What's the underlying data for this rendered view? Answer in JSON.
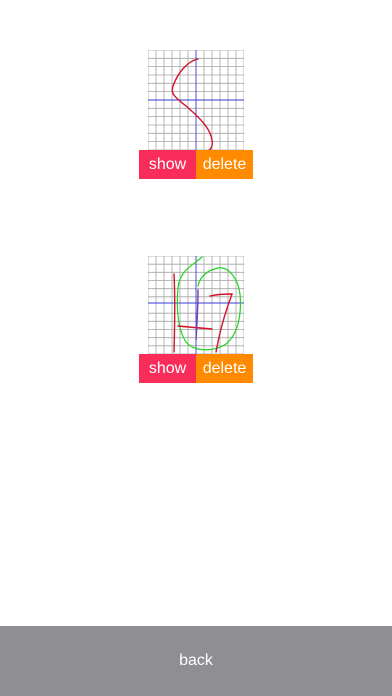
{
  "drawings": [
    {
      "show_label": "show",
      "delete_label": "delete",
      "stroke_colors": [
        "#d0132a"
      ]
    },
    {
      "show_label": "show",
      "delete_label": "delete",
      "stroke_colors": [
        "#d0132a",
        "#1ed51e",
        "#7a3aa8"
      ]
    }
  ],
  "bottom_bar": {
    "back_label": "back"
  },
  "colors": {
    "show_button": "#fa2d5a",
    "delete_button": "#ff8a00",
    "bottom_bar": "#8e8e93",
    "grid_line": "#9a9a9a",
    "guide_line": "#3a3ad8"
  }
}
